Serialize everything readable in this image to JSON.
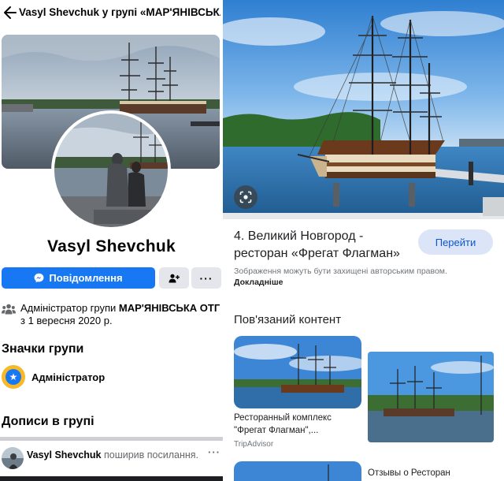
{
  "facebook": {
    "header": {
      "title": "Vasyl  Shevchuk у групі «МАР'ЯНІВСЬКА..."
    },
    "profile": {
      "name": "Vasyl  Shevchuk"
    },
    "actions": {
      "message_label": "Повідомлення",
      "more_label": "···"
    },
    "admin_info": {
      "prefix": "Адміністратор групи ",
      "group": "МАР'ЯНІВСЬКА ОТГ",
      "suffix": " з 1 вересня 2020 р."
    },
    "badges": {
      "heading": "Значки групи",
      "items": [
        {
          "label": "Адміністратор"
        }
      ]
    },
    "posts": {
      "heading": "Дописи в групі",
      "first": {
        "author": "Vasyl  Shevchuk",
        "action": " поширив посилання.",
        "more_label": "···"
      }
    }
  },
  "google": {
    "result": {
      "title": "4. Великий Новгород - ресторан «Фрегат Флагман»",
      "button_label": "Перейти",
      "copyright_text": "Зображення можуть бути захищені авторським правом. ",
      "copyright_link": "Докладніше"
    },
    "related": {
      "heading": "Пов'язаний контент",
      "items": [
        {
          "title": "Ресторанный комплекс \"Фрегат Флагман\",...",
          "source": "TripAdvisor"
        },
        {
          "title": "Отзывы о Ресторан"
        }
      ]
    }
  },
  "colors": {
    "facebook_blue": "#1877f2",
    "google_button_bg": "#dbe5f7",
    "google_button_text": "#0b57d0",
    "badge_gold": "#f7b928"
  },
  "icons": [
    "back-arrow-icon",
    "messenger-icon",
    "add-friend-icon",
    "more-icon",
    "group-icon",
    "admin-badge-icon",
    "google-lens-icon"
  ]
}
